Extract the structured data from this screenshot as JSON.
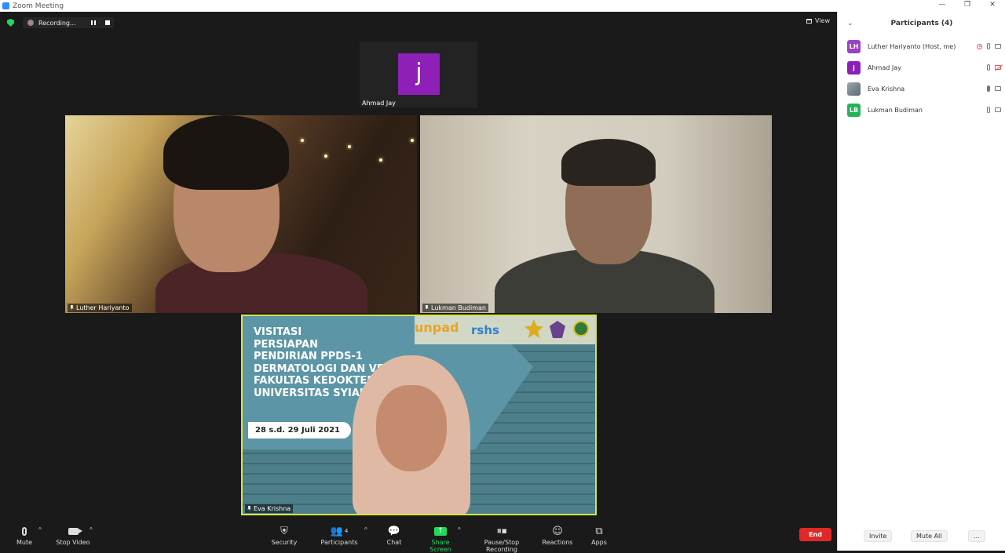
{
  "window": {
    "title": "Zoom Meeting",
    "controls": [
      "—",
      "❐",
      "✕"
    ]
  },
  "recording": {
    "label": "Recording..."
  },
  "view_label": "View",
  "thumbnail": {
    "initial": "j",
    "name": "Ahmad Jay",
    "color": "#8e1fb7"
  },
  "tiles": {
    "luther": {
      "name": "Luther Hariyanto"
    },
    "lukman": {
      "name": "Lukman Budiman"
    },
    "eva": {
      "name": "Eva Krishna",
      "slide": {
        "lines": [
          "VISITASI",
          "PERSIAPAN",
          "PENDIRIAN PPDS-1",
          "DERMATOLOGI DAN VENE",
          "FAKULTAS KEDOKTERA",
          "UNIVERSITAS SYIAH K"
        ],
        "date": "28 s.d. 29 Juli 2021",
        "logos": {
          "unpad": "unpad",
          "rshs": "rshs"
        }
      }
    }
  },
  "toolbar": {
    "mute": "Mute",
    "stop_video": "Stop Video",
    "security": "Security",
    "participants": "Participants",
    "participants_count": "4",
    "chat": "Chat",
    "share_screen": "Share Screen",
    "pause_stop": "Pause/Stop Recording",
    "reactions": "Reactions",
    "apps": "Apps",
    "end": "End"
  },
  "panel": {
    "title": "Participants (4)",
    "participants": [
      {
        "initials": "LH",
        "name": "Luther Hariyanto (Host, me)",
        "color": "#9b42c2"
      },
      {
        "initials": "j",
        "name": "Ahmad Jay",
        "color": "#8e1fb7"
      },
      {
        "initials": "",
        "name": "Eva Krishna",
        "color": "#7d8a93"
      },
      {
        "initials": "LB",
        "name": "Lukman Budiman",
        "color": "#23b45a"
      }
    ],
    "invite": "Invite",
    "mute_all": "Mute All",
    "more": "..."
  }
}
